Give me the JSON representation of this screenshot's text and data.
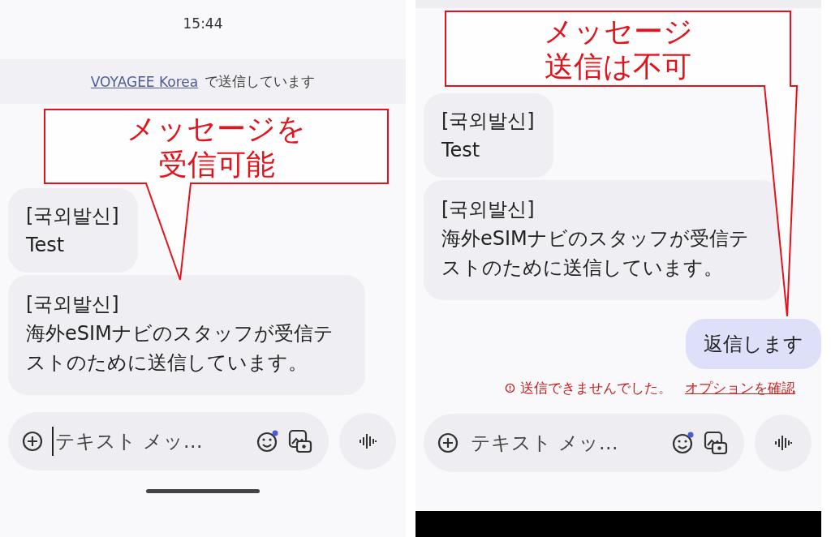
{
  "panels": [
    {
      "status_time": "15:44",
      "banner": {
        "link": "VOYAGEE Korea",
        "text": "で送信しています"
      },
      "messages": [
        {
          "kind": "incoming",
          "header": "[국외발신]",
          "body": "Test"
        },
        {
          "kind": "incoming",
          "header": "[국외발신]",
          "body": "海外eSIMナビのスタッフが受信テストのために送信しています。"
        }
      ],
      "composer": {
        "placeholder": "テキスト メッ…",
        "focused": true
      },
      "callout": {
        "lines": [
          "メッセージを",
          "受信可能"
        ]
      }
    },
    {
      "messages": [
        {
          "kind": "incoming",
          "header": "[국외발신]",
          "body": "Test"
        },
        {
          "kind": "incoming",
          "header": "[국외발신]",
          "body": "海外eSIMナビのスタッフが受信テストのために送信しています。"
        },
        {
          "kind": "outgoing",
          "body": "返信します"
        }
      ],
      "error": {
        "text": "送信できませんでした。",
        "link": "オプションを確認"
      },
      "composer": {
        "placeholder": "テキスト メッ…",
        "focused": false
      },
      "callout": {
        "lines": [
          "メッセージ",
          "送信は不可"
        ]
      }
    }
  ]
}
